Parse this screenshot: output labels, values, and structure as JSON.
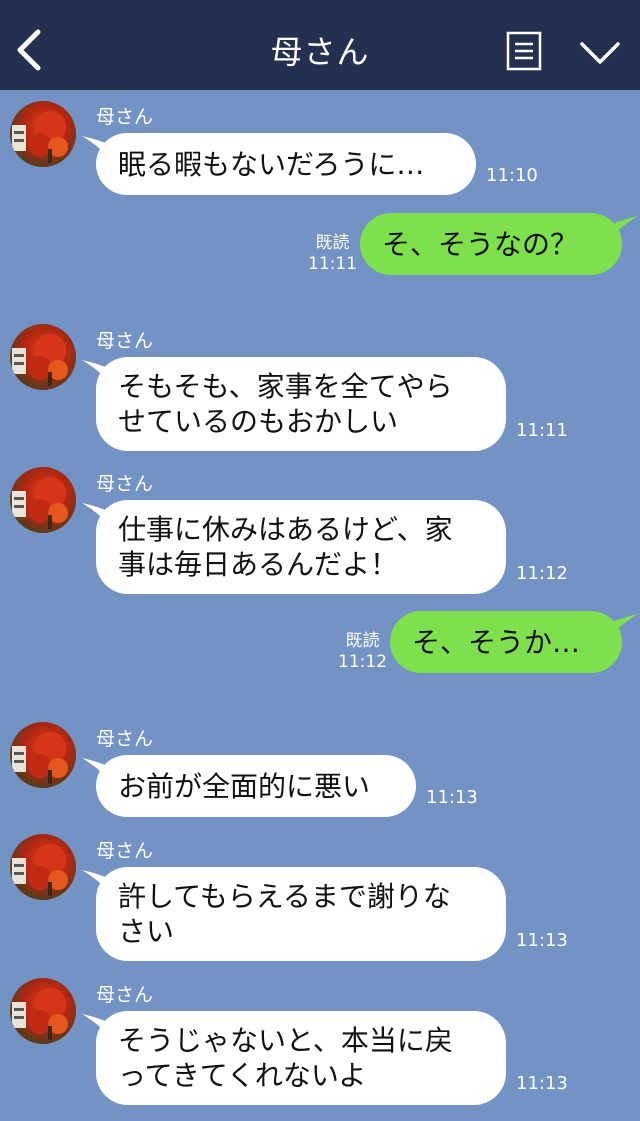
{
  "header": {
    "title": "母さん"
  },
  "colors": {
    "header_bg": "#243050",
    "chat_bg": "#7293c4",
    "out_bubble": "#7ee04d",
    "in_bubble": "#ffffff"
  },
  "icons": {
    "back": "chevron-left-icon",
    "menu": "menu-list-icon",
    "expand": "chevron-down-icon"
  },
  "read_label": "既読",
  "messages": [
    {
      "from": "母さん",
      "text": "眠る暇もないだろうに…",
      "time": "11:10"
    },
    {
      "from": "me",
      "text": "そ、そうなの？",
      "time": "11:11"
    },
    {
      "from": "母さん",
      "text": "そもそも、家事を全てやら\nせているのもおかしい",
      "time": "11:11"
    },
    {
      "from": "母さん",
      "text": "仕事に休みはあるけど、家\n事は毎日あるんだよ！",
      "time": "11:12"
    },
    {
      "from": "me",
      "text": "そ、そうか…",
      "time": "11:12"
    },
    {
      "from": "母さん",
      "text": "お前が全面的に悪い",
      "time": "11:13"
    },
    {
      "from": "母さん",
      "text": "許してもらえるまで謝りな\nさい",
      "time": "11:13"
    },
    {
      "from": "母さん",
      "text": "そうじゃないと、本当に戻\nってきてくれないよ",
      "time": "11:13"
    }
  ]
}
